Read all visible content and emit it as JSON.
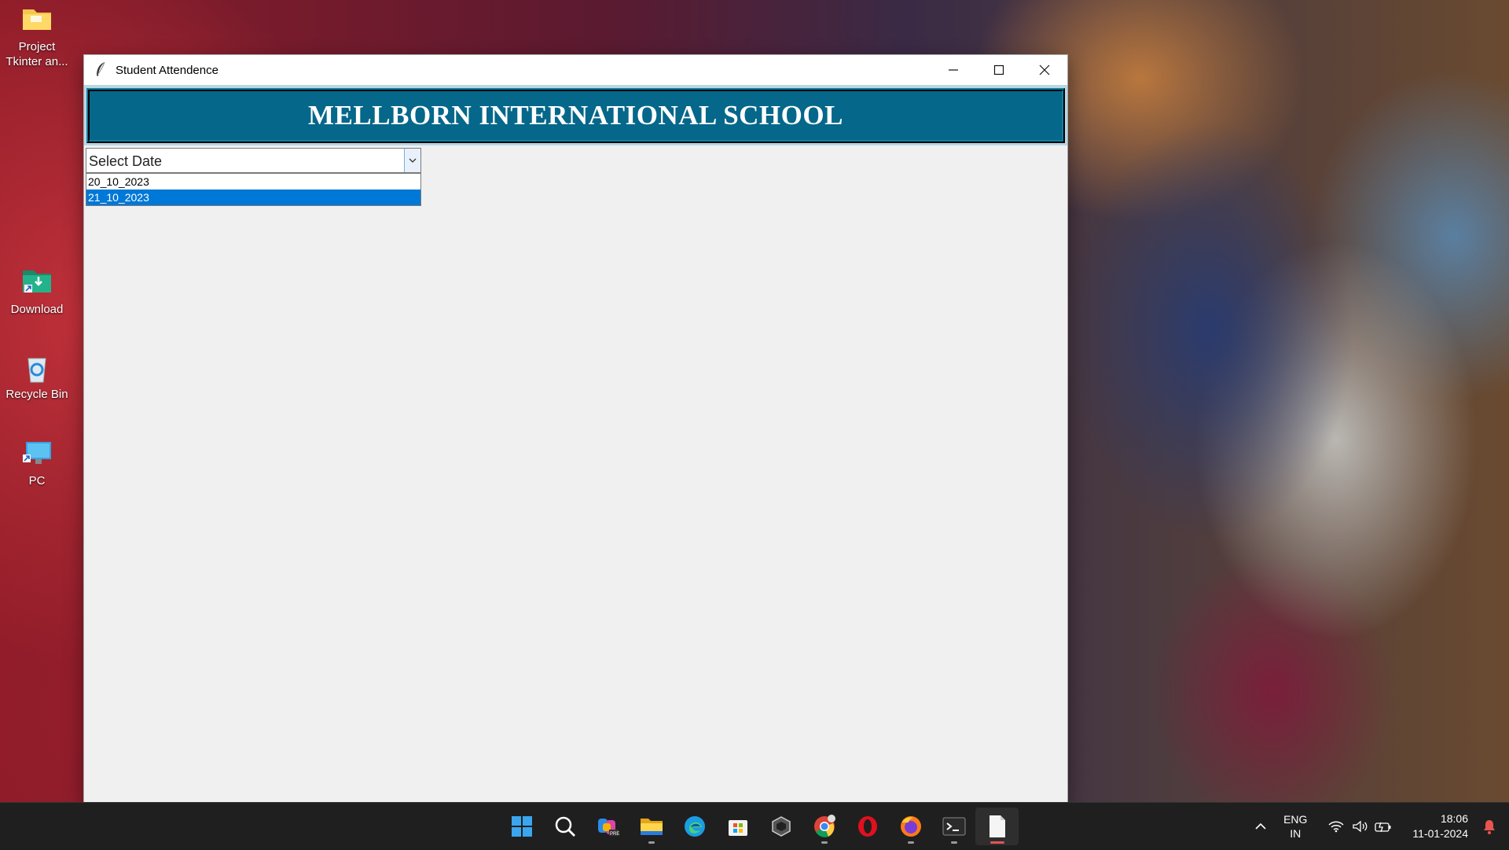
{
  "desktop": {
    "icons": [
      {
        "label": "Project\nTkinter an..."
      },
      {
        "label": "Download"
      },
      {
        "label": "Recycle Bin"
      },
      {
        "label": "PC"
      }
    ]
  },
  "window": {
    "title": "Student Attendence",
    "buttons": {
      "minimize": "minimize-icon",
      "maximize": "maximize-icon",
      "close": "close-icon"
    },
    "banner": "MELLBORN INTERNATIONAL SCHOOL",
    "banner_color": "#05678a",
    "combobox": {
      "value": "Select Date",
      "options": [
        "20_10_2023",
        "21_10_2023"
      ],
      "selected_index": 1
    }
  },
  "taskbar": {
    "apps": [
      "start-icon",
      "search-icon",
      "copilot-icon",
      "file-explorer-icon",
      "edge-icon",
      "store-icon",
      "unity-icon",
      "chrome-icon",
      "opera-icon",
      "firefox-icon",
      "terminal-icon",
      "notepad-icon"
    ],
    "tray": {
      "lang_line1": "ENG",
      "lang_line2": "IN",
      "time": "18:06",
      "date": "11-01-2024"
    }
  },
  "colors": {
    "selection": "#0078d7",
    "taskbar": "#1f1f1f"
  }
}
